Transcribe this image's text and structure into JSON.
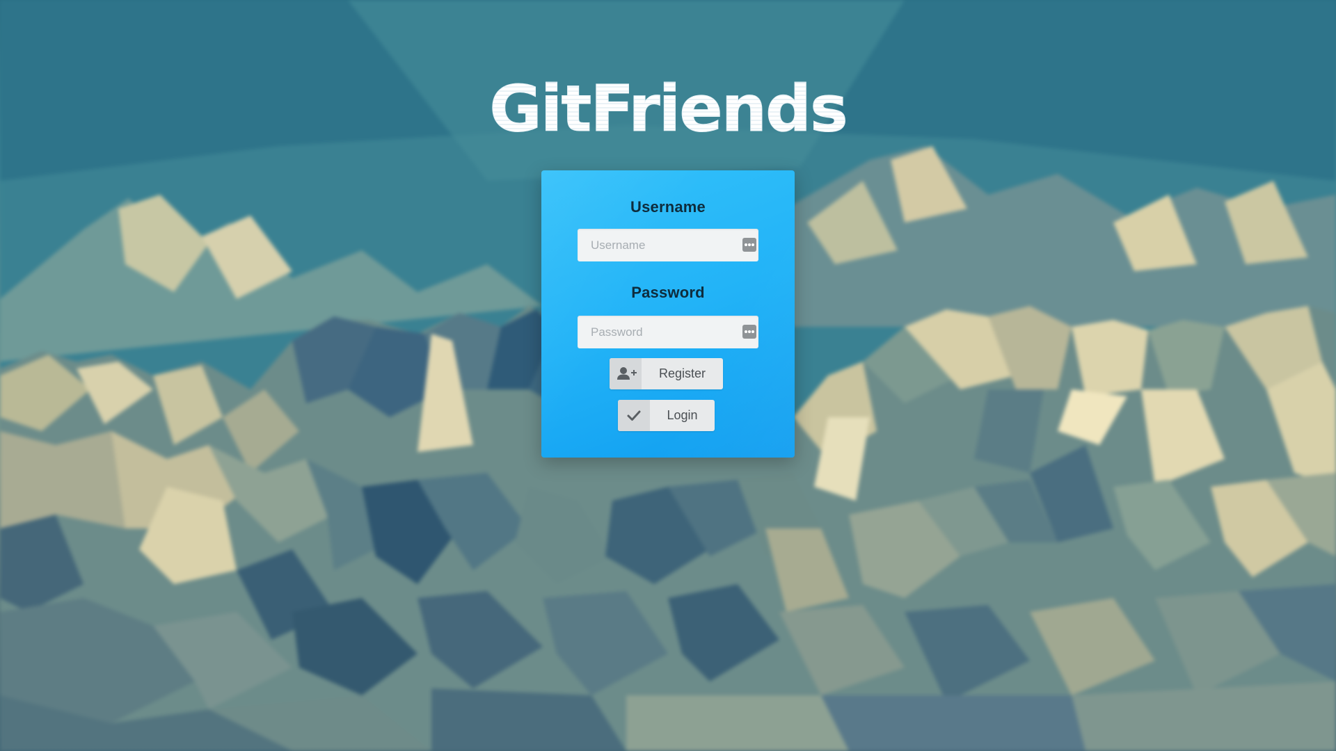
{
  "app": {
    "logo_text": "GitFriends"
  },
  "login_form": {
    "username_label": "Username",
    "username_placeholder": "Username",
    "username_value": "",
    "password_label": "Password",
    "password_placeholder": "Password",
    "password_value": "",
    "register_label": "Register",
    "login_label": "Login",
    "icons": {
      "username_field": "password-manager-dots-icon",
      "password_field": "password-manager-dots-icon",
      "register": "add-user-icon",
      "login": "checkmark-icon"
    }
  },
  "colors": {
    "panel_accent": "#22b3f7",
    "button_bg": "#e8eaeb",
    "label_text": "#0e2c3d"
  }
}
